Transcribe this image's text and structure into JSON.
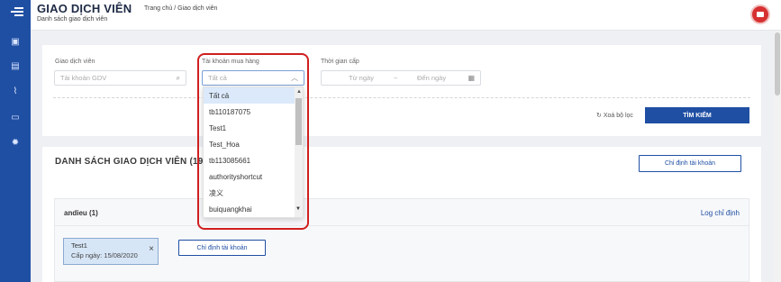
{
  "header": {
    "title": "GIAO DỊCH VIÊN",
    "subtitle": "Danh sách giao dịch viên",
    "breadcrumb": "Trang chủ  / Giao dịch viên"
  },
  "sidebar": {
    "icons": [
      "menu-icon",
      "wallet-icon",
      "document-icon",
      "chart-icon",
      "card-icon",
      "settings-icon"
    ]
  },
  "filters": {
    "gdv_label": "Giao dịch viên",
    "gdv_placeholder": "Tài khoản GDV",
    "account_label": "Tài khoản mua hàng",
    "account_placeholder": "Tất cả",
    "date_label": "Thời gian cấp",
    "date_from": "Từ ngày",
    "date_separator": "~",
    "date_to": "Đến ngày",
    "clear_label": "Xoá bộ lọc",
    "search_label": "TÌM KIẾM"
  },
  "dropdown": {
    "options": [
      "Tất cả",
      "tb110187075",
      "Test1",
      "Test_Hoa",
      "tb113085661",
      "authorityshortcut",
      "凌义",
      "buiquangkhai"
    ],
    "selected": "Tất cả"
  },
  "list": {
    "title": "DANH SÁCH GIAO DỊCH VIÊN (19)",
    "assign_label": "Chỉ định tài khoản",
    "group": {
      "name": "andieu (1)",
      "log_label": "Log chỉ định",
      "chip_name": "Test1",
      "chip_date": "Cấp ngày: 15/08/2020",
      "assign_label": "Chỉ định tài khoản"
    }
  },
  "colors": {
    "primary": "#1f4fa3",
    "highlight": "#d01f1f"
  }
}
